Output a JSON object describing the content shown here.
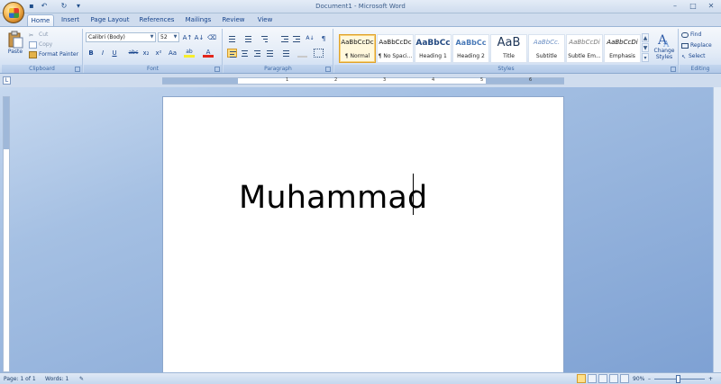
{
  "window": {
    "title": "Document1 - Microsoft Word"
  },
  "quick_access": [
    {
      "name": "save-icon",
      "glyph": "▪"
    },
    {
      "name": "undo-icon",
      "glyph": "↶"
    },
    {
      "name": "redo-icon",
      "glyph": "↻"
    },
    {
      "name": "customize-icon",
      "glyph": "▾"
    }
  ],
  "window_controls": {
    "minimize": "–",
    "maximize": "□",
    "close": "✕"
  },
  "tabs": [
    "Home",
    "Insert",
    "Page Layout",
    "References",
    "Mailings",
    "Review",
    "View"
  ],
  "ribbon": {
    "clipboard": {
      "label": "Clipboard",
      "paste": "Paste",
      "cut": "Cut",
      "copy": "Copy",
      "format_painter": "Format Painter"
    },
    "font": {
      "label": "Font",
      "font_name": "Calibri (Body)",
      "font_size": "52",
      "grow": "A↑",
      "shrink": "A↓",
      "clear": "⌫",
      "bold": "B",
      "italic": "I",
      "underline": "U",
      "strike": "abc",
      "subscript": "x₂",
      "superscript": "x²",
      "change_case": "Aa",
      "highlight": "ab",
      "font_color": "A"
    },
    "paragraph": {
      "label": "Paragraph",
      "show_marks": "¶",
      "sort": "A↓"
    },
    "styles": {
      "label": "Styles",
      "items": [
        {
          "sample": "AaBbCcDc",
          "name": "¶ Normal"
        },
        {
          "sample": "AaBbCcDc",
          "name": "¶ No Spaci..."
        },
        {
          "sample": "AaBbCc",
          "name": "Heading 1"
        },
        {
          "sample": "AaBbCc",
          "name": "Heading 2"
        },
        {
          "sample": "AaB",
          "name": "Title"
        },
        {
          "sample": "AaBbCc.",
          "name": "Subtitle"
        },
        {
          "sample": "AaBbCcDi",
          "name": "Subtle Em..."
        },
        {
          "sample": "AaBbCcDi",
          "name": "Emphasis"
        }
      ],
      "change_styles": "Change Styles"
    },
    "editing": {
      "label": "Editing",
      "find": "Find",
      "replace": "Replace",
      "select": "Select"
    }
  },
  "ruler": {
    "corner": "L",
    "marks": [
      "1",
      "2",
      "3",
      "4",
      "5",
      "6"
    ]
  },
  "document": {
    "text": "Muhammad"
  },
  "status": {
    "page": "Page: 1 of 1",
    "words": "Words: 1",
    "zoom": "90%",
    "zoom_out": "–",
    "zoom_in": "+",
    "zoom_level": 0.48
  },
  "colors": {
    "accent": "#15428b",
    "ribbon": "#dbe6f4",
    "workspace": "#92b0dc"
  }
}
